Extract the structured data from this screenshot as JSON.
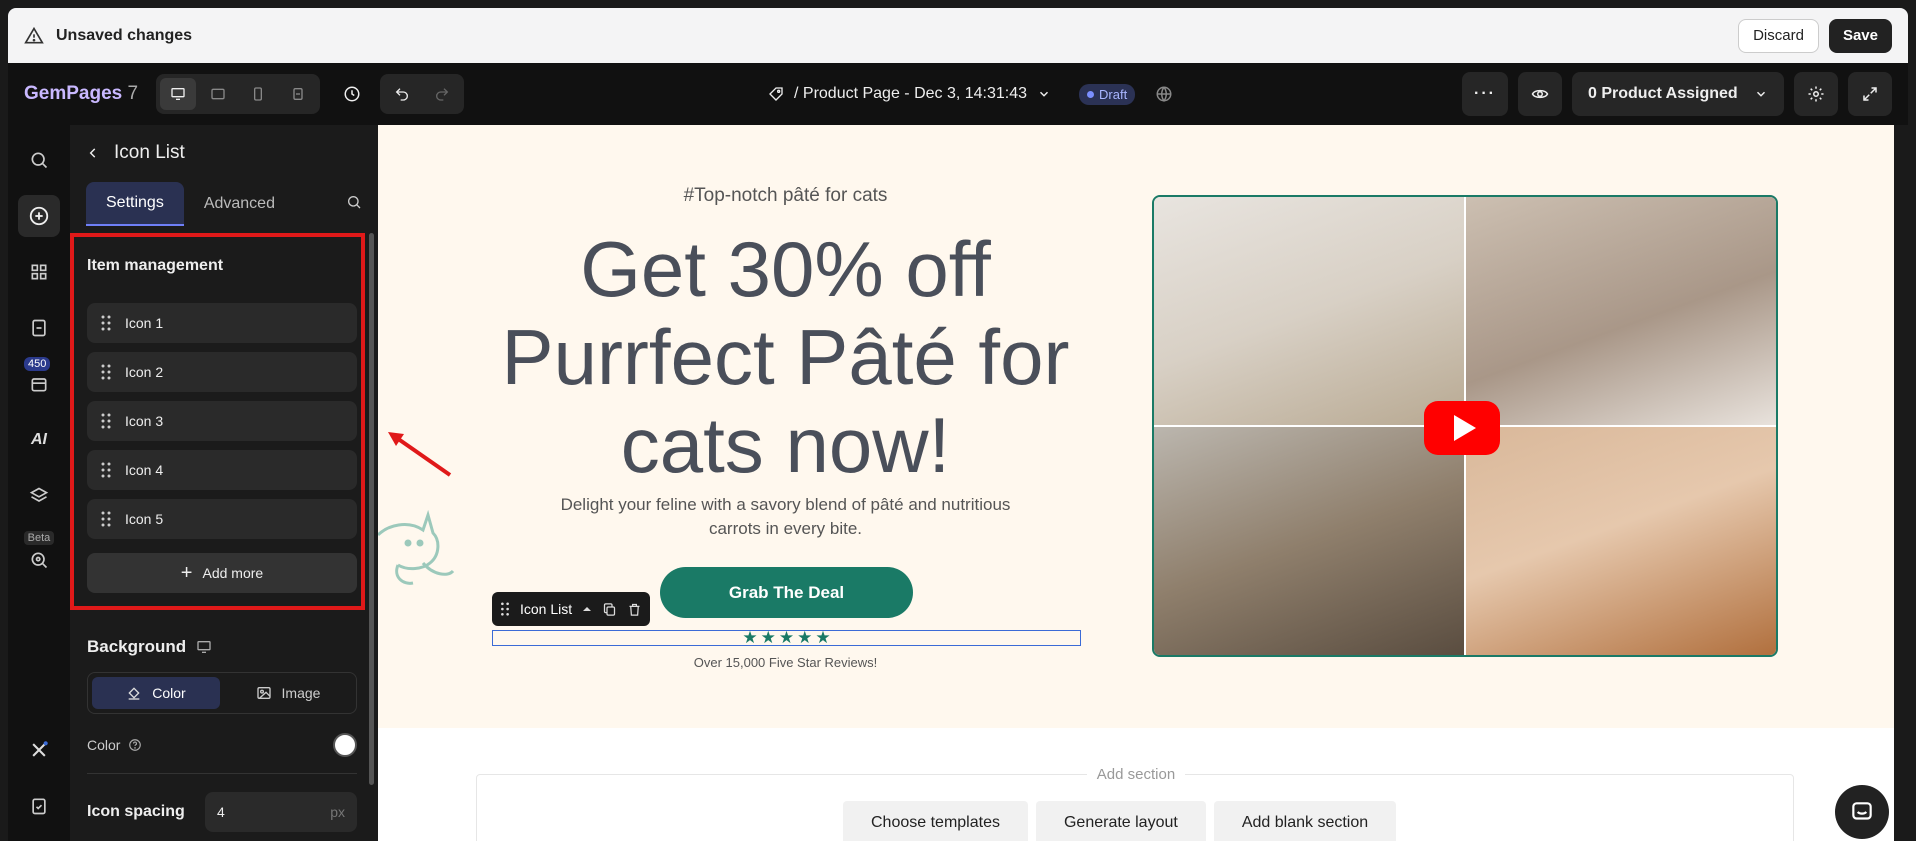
{
  "unsaved_bar": {
    "title": "Unsaved changes",
    "discard_label": "Discard",
    "save_label": "Save"
  },
  "toolbar": {
    "logo": "GemPages",
    "logo_version": "7",
    "page_title": "/ Product Page - Dec 3, 14:31:43",
    "status_badge": "Draft",
    "product_assigned": "0 Product Assigned"
  },
  "rail": {
    "badge_count": "450",
    "ai_label": "AI",
    "beta_label": "Beta"
  },
  "panel": {
    "header_title": "Icon List",
    "tabs": [
      "Settings",
      "Advanced"
    ],
    "section_title": "Item management",
    "items": [
      "Icon 1",
      "Icon 2",
      "Icon 3",
      "Icon 4",
      "Icon 5"
    ],
    "add_more_label": "Add more",
    "background_label": "Background",
    "bg_options": [
      "Color",
      "Image"
    ],
    "color_label": "Color",
    "icon_spacing_label": "Icon spacing",
    "icon_spacing_value": "4",
    "icon_spacing_unit": "px"
  },
  "canvas": {
    "hashtag": "#Top-notch pâté for cats",
    "headline_lines": [
      "Get 30% off",
      "Purrfect Pâté for",
      "cats now!"
    ],
    "subtitle": "Delight your feline with a savory blend of pâté and nutritious carrots in every bite.",
    "cta_label": "Grab The Deal",
    "selection_toolbar_label": "Icon List",
    "stars": 5,
    "reviews_text": "Over 15,000 Five Star Reviews!",
    "add_section_label": "Add section",
    "add_buttons": [
      "Choose templates",
      "Generate layout",
      "Add blank section"
    ]
  },
  "colors": {
    "accent_green": "#1a7a66",
    "highlight_red": "#e01919",
    "tab_active": "#2a3152",
    "youtube_red": "#ff0000"
  }
}
